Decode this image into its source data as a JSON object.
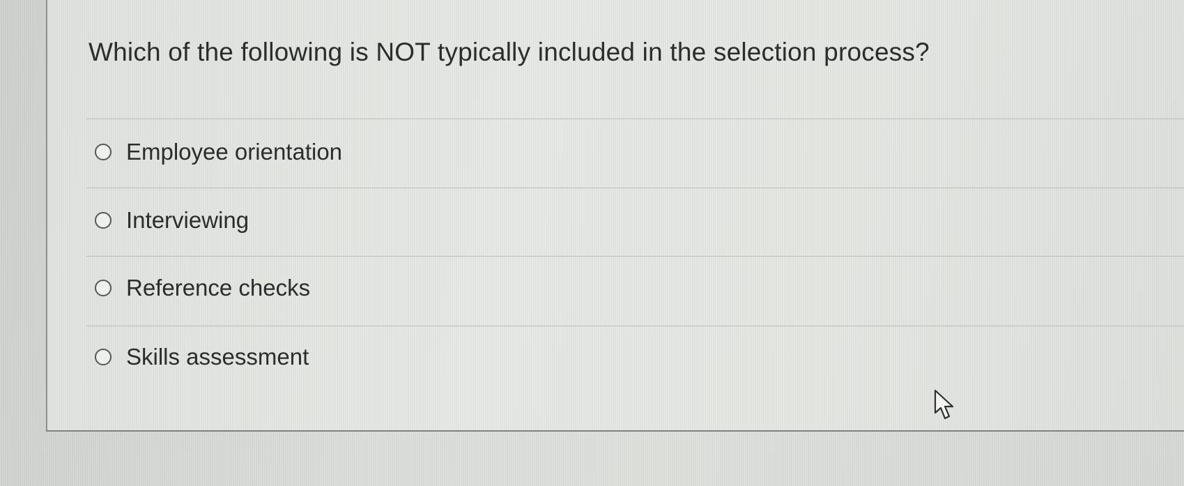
{
  "question": {
    "text": "Which of the following is NOT typically included in the selection process?"
  },
  "options": [
    {
      "label": "Employee orientation",
      "selected": false
    },
    {
      "label": "Interviewing",
      "selected": false
    },
    {
      "label": "Reference checks",
      "selected": false
    },
    {
      "label": "Skills assessment",
      "selected": false
    }
  ],
  "pointer": {
    "icon": "mouse-pointer-icon"
  },
  "colors": {
    "text": "#2b2d2d",
    "background": "#e3e5e1",
    "divider": "#b9bcb8",
    "radio_border": "#555857"
  }
}
